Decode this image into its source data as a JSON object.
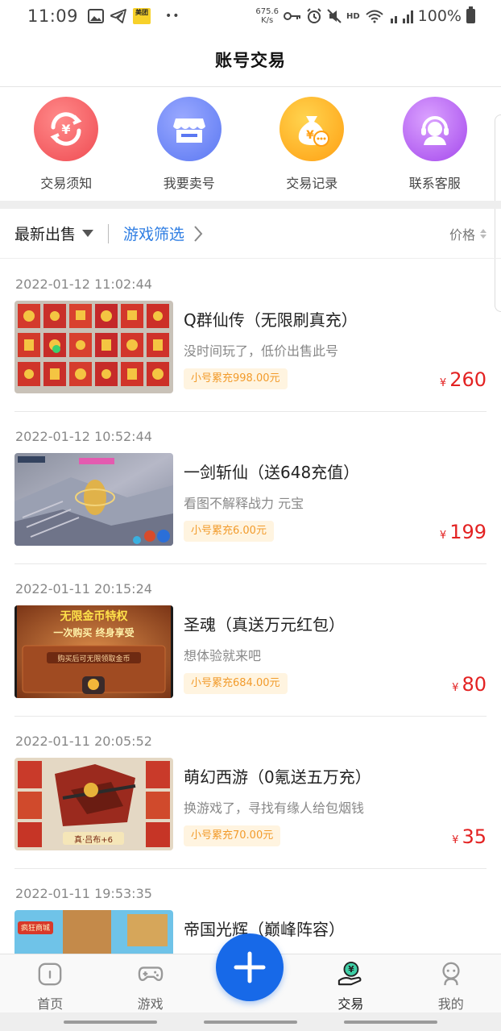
{
  "status_bar": {
    "time": "11:09",
    "meituan_badge": "美团",
    "dots": "••",
    "net_speed_value": "675.6",
    "net_speed_unit": "K/s",
    "hd": "HD",
    "battery": "100%",
    "icons": [
      "image-icon",
      "telegram-icon",
      "meituan-icon",
      "key-icon",
      "alarm-icon",
      "mute-icon",
      "wifi-icon",
      "signal-icon",
      "battery-icon"
    ]
  },
  "header": {
    "title": "账号交易"
  },
  "quick_actions": [
    {
      "label": "交易须知",
      "icon": "exchange-cycle-icon",
      "color": "#ef4b52"
    },
    {
      "label": "我要卖号",
      "icon": "store-icon",
      "color": "#5b78f2"
    },
    {
      "label": "交易记录",
      "icon": "money-bag-icon",
      "color": "#ff9f12"
    },
    {
      "label": "联系客服",
      "icon": "headset-agent-icon",
      "color": "#a448ec"
    }
  ],
  "filter": {
    "latest": "最新出售",
    "game_filter": "游戏筛选",
    "price": "价格"
  },
  "currency_symbol": "¥",
  "listings": [
    {
      "date": "2022-01-12 11:02:44",
      "title": "Q群仙传（无限刷真充）",
      "desc": "没时间玩了，低价出售此号",
      "tag": "小号累充998.00元",
      "price": "260"
    },
    {
      "date": "2022-01-12 10:52:44",
      "title": "一剑斩仙（送648充值）",
      "desc": "看图不解释战力 元宝",
      "tag": "小号累充6.00元",
      "price": "199"
    },
    {
      "date": "2022-01-11 20:15:24",
      "title": "圣魂（真送万元红包）",
      "desc": "想体验就来吧",
      "tag": "小号累充684.00元",
      "price": "80"
    },
    {
      "date": "2022-01-11 20:05:52",
      "title": "萌幻西游（0氪送五万充）",
      "desc": "换游戏了，寻找有缘人给包烟钱",
      "tag": "小号累充70.00元",
      "price": "35"
    },
    {
      "date": "2022-01-11 19:53:35",
      "title": "帝国光辉（巅峰阵容）",
      "desc": "",
      "tag": "",
      "price": ""
    }
  ],
  "thumb_text": {
    "t3_line1": "无限金币特权",
    "t3_line2": "一次购买 终身享受",
    "t3_line3": "购买后可无限领取金币",
    "t4_caption": "真·吕布+6",
    "t5_badge": "疯狂商城"
  },
  "bottom_nav": {
    "items": [
      {
        "label": "首页",
        "icon": "home-icon",
        "active": false
      },
      {
        "label": "游戏",
        "icon": "gamepad-icon",
        "active": false
      },
      {
        "label": "交易",
        "icon": "trade-hand-icon",
        "active": true
      },
      {
        "label": "我的",
        "icon": "profile-icon",
        "active": false
      }
    ],
    "fab_icon": "plus-icon",
    "accent": "#1769e8"
  },
  "colors": {
    "price_red": "#e32222",
    "link_blue": "#2f7ee3",
    "tag_orange": "#f29b2b"
  }
}
